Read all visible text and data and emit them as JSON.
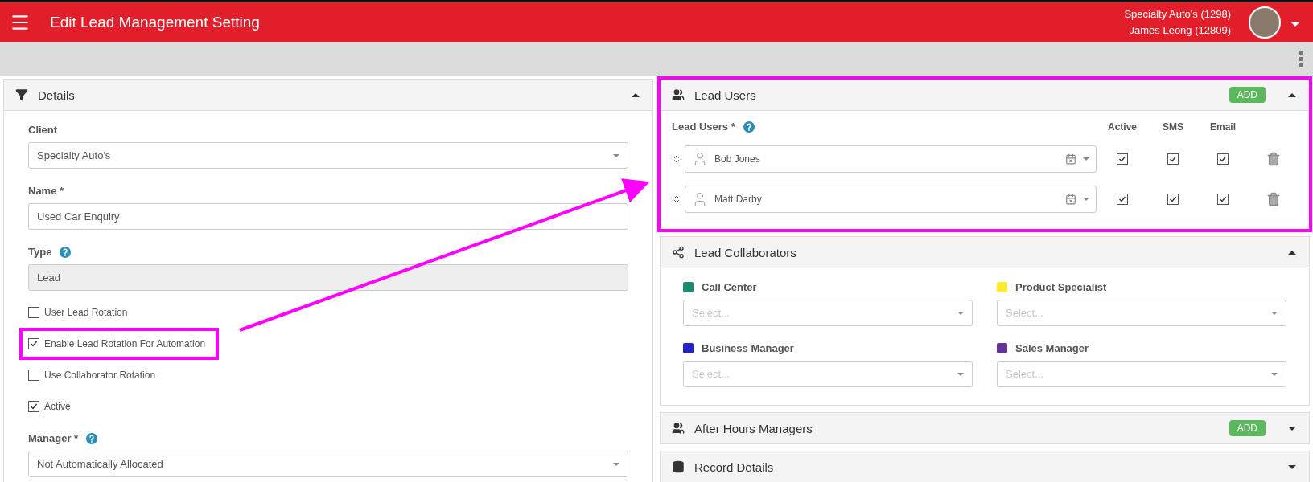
{
  "header": {
    "title": "Edit Lead Management Setting",
    "client": "Specialty Auto's (1298)",
    "user": "James Leong (12809)"
  },
  "details": {
    "title": "Details",
    "expanded": true,
    "items": [
      {
        "kind": "select",
        "label": "Client",
        "help": false,
        "value": "Specialty Auto's",
        "disabled": false
      },
      {
        "kind": "input",
        "label": "Name *",
        "help": false,
        "value": "Used Car Enquiry",
        "disabled": false
      },
      {
        "kind": "input",
        "label": "Type",
        "help": true,
        "value": "Lead",
        "disabled": true
      },
      {
        "kind": "checkbox",
        "label": "User Lead Rotation",
        "checked": false
      },
      {
        "kind": "checkbox",
        "label": "Enable Lead Rotation For Automation",
        "checked": true,
        "highlighted": true
      },
      {
        "kind": "checkbox",
        "label": "Use Collaborator Rotation",
        "checked": false
      },
      {
        "kind": "checkbox",
        "label": "Active",
        "checked": true
      },
      {
        "kind": "select",
        "label": "Manager *",
        "help": true,
        "value": "Not Automatically Allocated",
        "disabled": false
      }
    ]
  },
  "lead_users": {
    "title": "Lead Users",
    "expanded": true,
    "highlighted": true,
    "add_label": "ADD",
    "field_label": "Lead Users *",
    "columns": [
      "Active",
      "SMS",
      "Email"
    ],
    "rows": [
      {
        "name": "Bob Jones",
        "active": true,
        "sms": true,
        "email": true
      },
      {
        "name": "Matt Darby",
        "active": true,
        "sms": true,
        "email": true
      }
    ]
  },
  "collaborators": {
    "title": "Lead Collaborators",
    "expanded": true,
    "roles": [
      {
        "label": "Call Center",
        "color": "#1f8a6e",
        "placeholder": "Select..."
      },
      {
        "label": "Product Specialist",
        "color": "#fdeb2c",
        "placeholder": "Select..."
      },
      {
        "label": "Business Manager",
        "color": "#2424c0",
        "placeholder": "Select..."
      },
      {
        "label": "Sales Manager",
        "color": "#663399",
        "placeholder": "Select..."
      }
    ]
  },
  "after_hours": {
    "title": "After Hours Managers",
    "expanded": false,
    "add_label": "ADD"
  },
  "record_details": {
    "title": "Record Details",
    "expanded": false
  }
}
